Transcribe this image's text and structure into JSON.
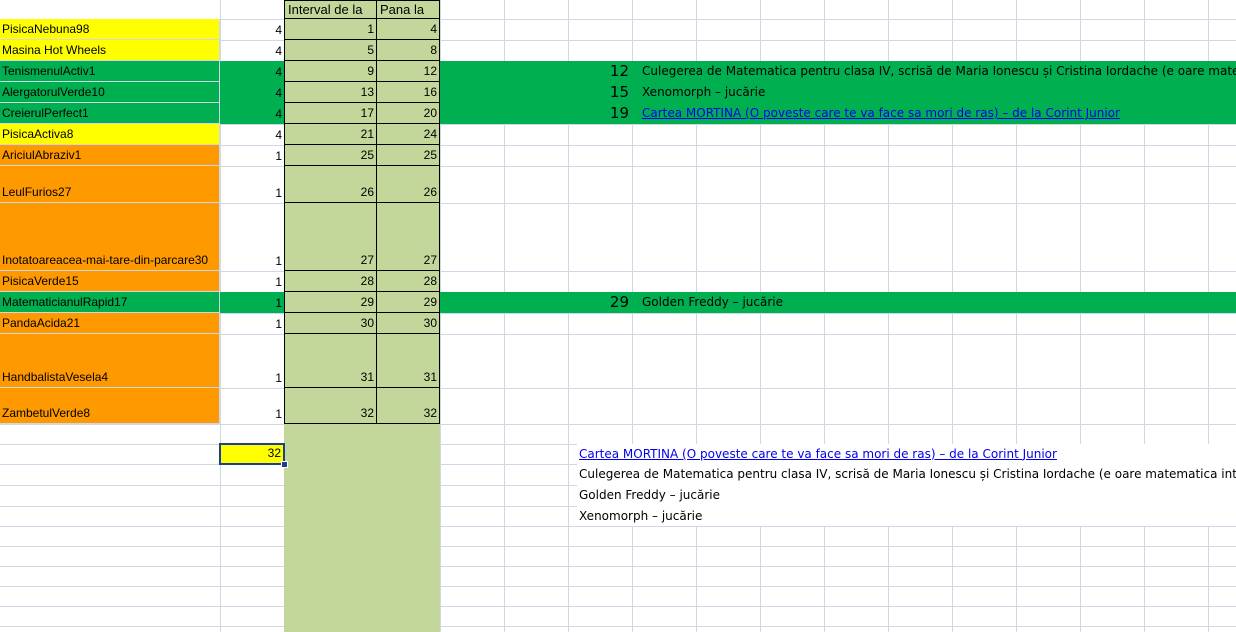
{
  "colors": {
    "yellow": "#ffff00",
    "green": "#00b050",
    "orange": "#ff9900",
    "olive": "#c4d79b",
    "link": "#0000ee",
    "gridline": "#d0d7e5"
  },
  "headers": {
    "interval_from": "Interval de la",
    "until": "Pana la"
  },
  "rows": [
    {
      "name": "PisicaNebuna98",
      "count": "4",
      "from": "1",
      "to": "4",
      "color": "#ffff00"
    },
    {
      "name": "Masina Hot Wheels",
      "count": "4",
      "from": "5",
      "to": "8",
      "color": "#ffff00"
    },
    {
      "name": "TenismenulActiv1",
      "count": "4",
      "from": "9",
      "to": "12",
      "color": "#00b050"
    },
    {
      "name": "AlergatorulVerde10",
      "count": "4",
      "from": "13",
      "to": "16",
      "color": "#00b050"
    },
    {
      "name": "CreierulPerfect1",
      "count": "4",
      "from": "17",
      "to": "20",
      "color": "#00b050"
    },
    {
      "name": "PisicaActiva8",
      "count": "4",
      "from": "21",
      "to": "24",
      "color": "#ffff00"
    },
    {
      "name": "AriciulAbraziv1",
      "count": "1",
      "from": "25",
      "to": "25",
      "color": "#ff9900"
    },
    {
      "name": "LeulFurios27",
      "count": "1",
      "from": "26",
      "to": "26",
      "color": "#ff9900"
    },
    {
      "name": "Inotatoareacea-mai-tare-din-parcare30",
      "count": "1",
      "from": "27",
      "to": "27",
      "color": "#ff9900"
    },
    {
      "name": "PisicaVerde15",
      "count": "1",
      "from": "28",
      "to": "28",
      "color": "#ff9900"
    },
    {
      "name": "MatematicianulRapid17",
      "count": "1",
      "from": "29",
      "to": "29",
      "color": "#00b050"
    },
    {
      "name": "PandaAcida21",
      "count": "1",
      "from": "30",
      "to": "30",
      "color": "#ff9900"
    },
    {
      "name": "HandbalistaVesela4",
      "count": "1",
      "from": "31",
      "to": "31",
      "color": "#ff9900"
    },
    {
      "name": "ZambetulVerde8",
      "count": "1",
      "from": "32",
      "to": "32",
      "color": "#ff9900"
    }
  ],
  "total": "32",
  "prizes": [
    {
      "number": "12",
      "title": "Culegerea de Matematica pentru clasa IV, scrisă de Maria Ionescu și Cristina Iordache (e oare matematica interesanta?) - Sint",
      "link": false
    },
    {
      "number": "15",
      "title": "Xenomorph – jucărie",
      "link": false
    },
    {
      "number": "19",
      "title": "Cartea MORTINA (O poveste care te va face sa mori de ras) – de la Corint Junior",
      "link": true
    },
    {
      "number": "29",
      "title": "Golden Freddy – jucărie",
      "link": false
    }
  ],
  "prize_list": [
    {
      "title": "Cartea MORTINA (O poveste care te va face sa mori de ras) – de la Corint Junior",
      "link": true
    },
    {
      "title": "Culegerea de Matematica pentru clasa IV, scrisă de Maria Ionescu și Cristina Iordache (e oare matematica interesanta?) - Sint",
      "link": false
    },
    {
      "title": "Golden Freddy – jucărie",
      "link": false
    },
    {
      "title": "Xenomorph – jucărie",
      "link": false
    }
  ]
}
